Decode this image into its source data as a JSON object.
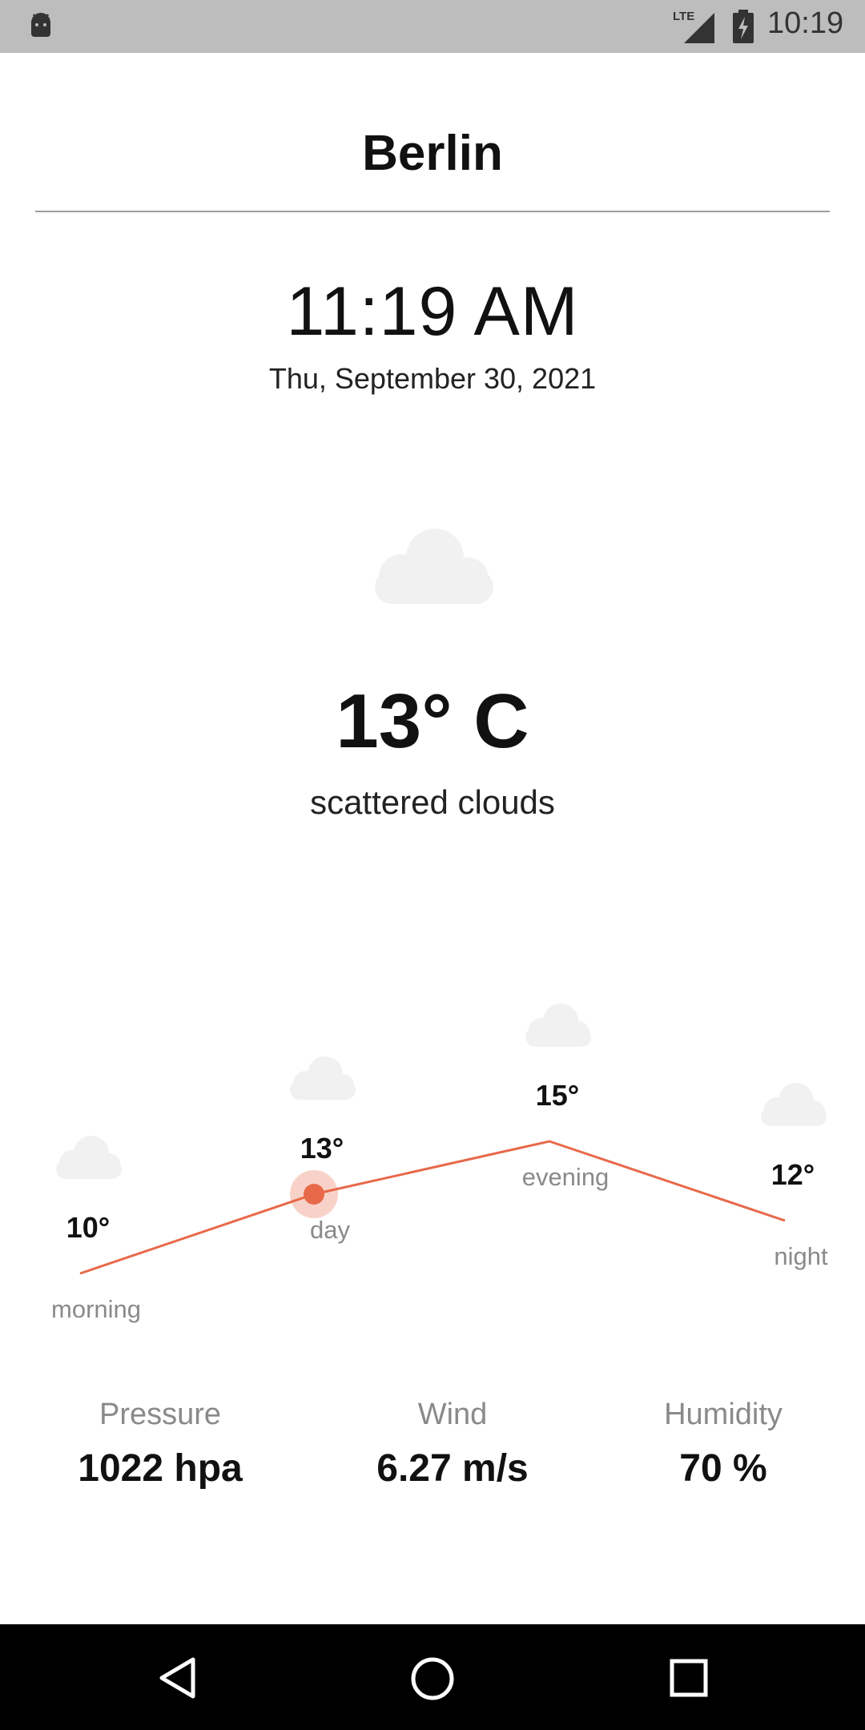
{
  "status_bar": {
    "clock": "10:19",
    "network": "LTE",
    "icons": [
      "android-icon",
      "signal-icon",
      "battery-charging-icon"
    ]
  },
  "header": {
    "city": "Berlin",
    "time": "11:19 AM",
    "date": "Thu, September 30, 2021"
  },
  "current": {
    "icon": "cloud-icon",
    "temperature": "13° C",
    "description": "scattered clouds"
  },
  "forecast": {
    "line_color": "#e8694a",
    "highlight_index": 1,
    "periods": [
      {
        "label": "morning",
        "temp_label": "10°",
        "temp": 10,
        "icon": "cloud-icon"
      },
      {
        "label": "day",
        "temp_label": "13°",
        "temp": 13,
        "icon": "cloud-icon"
      },
      {
        "label": "evening",
        "temp_label": "15°",
        "temp": 15,
        "icon": "cloud-icon"
      },
      {
        "label": "night",
        "temp_label": "12°",
        "temp": 12,
        "icon": "cloud-icon"
      }
    ]
  },
  "stats": [
    {
      "label": "Pressure",
      "value": "1022 hpa"
    },
    {
      "label": "Wind",
      "value": "6.27 m/s"
    },
    {
      "label": "Humidity",
      "value": "70 %"
    }
  ],
  "nav_bar": {
    "icons": [
      "back-icon",
      "home-icon",
      "recents-icon"
    ]
  }
}
